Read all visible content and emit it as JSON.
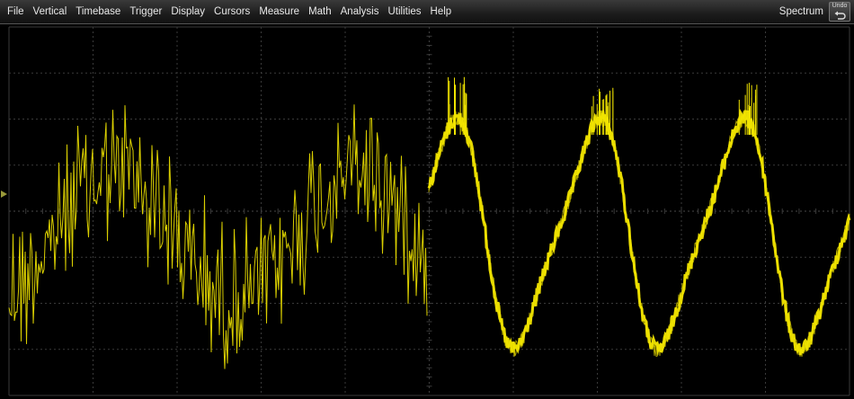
{
  "menubar": {
    "items": [
      "File",
      "Vertical",
      "Timebase",
      "Trigger",
      "Display",
      "Cursors",
      "Measure",
      "Math",
      "Analysis",
      "Utilities",
      "Help"
    ],
    "right_label": "Spectrum",
    "undo_label": "Undo"
  },
  "display": {
    "background": "#000000",
    "grid_color": "#3a3a3a",
    "trace_color": "#f2e500",
    "channel_marker_color": "#9a9a3a",
    "grid_divisions": {
      "horizontal": 10,
      "vertical": 8
    }
  },
  "icons": {
    "undo": "undo-arrow-icon"
  }
}
